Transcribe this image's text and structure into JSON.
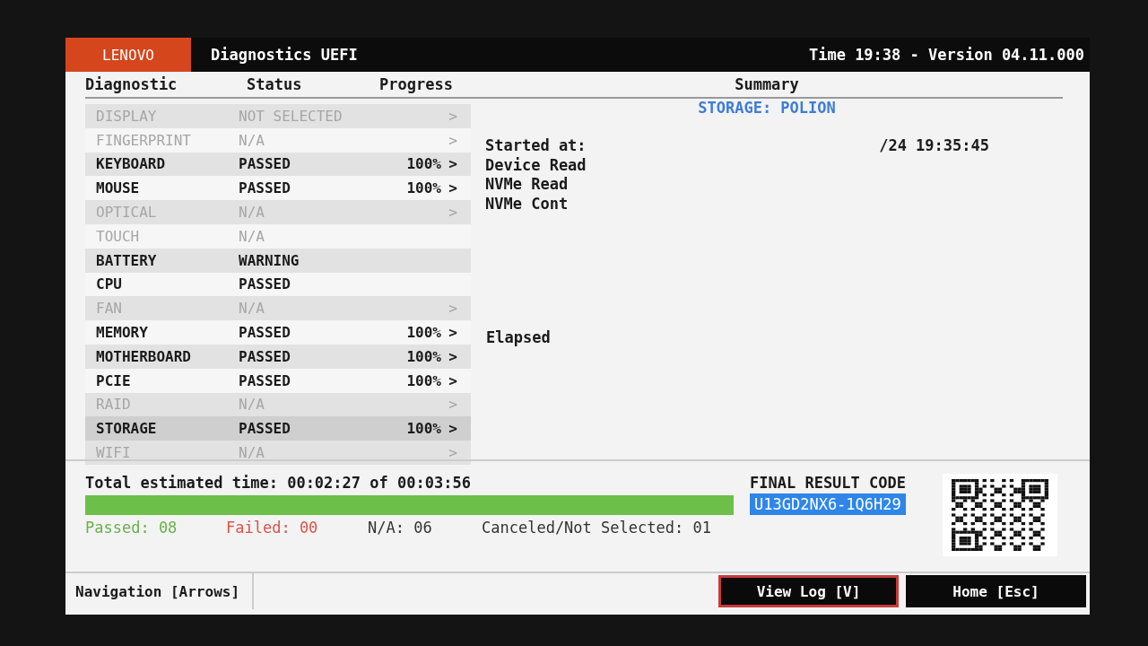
{
  "header": {
    "brand": "LENOVO",
    "title": "Diagnostics UEFI",
    "info": "Time 19:38 - Version 04.11.000"
  },
  "table": {
    "columns": [
      "Diagnostic",
      "Status",
      "Progress"
    ],
    "rows": [
      {
        "name": "DISPLAY",
        "status": "NOT SELECTED",
        "chevron": ">",
        "disabled": true,
        "selected": false
      },
      {
        "name": "FINGERPRINT",
        "status": "N/A",
        "chevron": ">",
        "disabled": true,
        "selected": false
      },
      {
        "name": "KEYBOARD",
        "status": "PASSED",
        "progress": "100%",
        "chevron": ">",
        "disabled": false,
        "selected": false
      },
      {
        "name": "MOUSE",
        "status": "PASSED",
        "progress": "100%",
        "chevron": ">",
        "disabled": false,
        "selected": false
      },
      {
        "name": "OPTICAL",
        "status": "N/A",
        "chevron": ">",
        "disabled": true,
        "selected": false
      },
      {
        "name": "TOUCH",
        "status": "N/A",
        "disabled": true,
        "selected": false
      },
      {
        "name": "BATTERY",
        "status": "WARNING",
        "disabled": false,
        "selected": false
      },
      {
        "name": "CPU",
        "status": "PASSED",
        "disabled": false,
        "selected": false
      },
      {
        "name": "FAN",
        "status": "N/A",
        "chevron": ">",
        "disabled": true,
        "selected": false
      },
      {
        "name": "MEMORY",
        "status": "PASSED",
        "progress": "100%",
        "chevron": ">",
        "disabled": false,
        "selected": false
      },
      {
        "name": "MOTHERBOARD",
        "status": "PASSED",
        "progress": "100%",
        "chevron": ">",
        "disabled": false,
        "selected": false
      },
      {
        "name": "PCIE",
        "status": "PASSED",
        "progress": "100%",
        "chevron": ">",
        "disabled": false,
        "selected": false
      },
      {
        "name": "RAID",
        "status": "N/A",
        "chevron": ">",
        "disabled": true,
        "selected": false
      },
      {
        "name": "STORAGE",
        "status": "PASSED",
        "progress": "100%",
        "chevron": ">",
        "disabled": false,
        "selected": true
      },
      {
        "name": "WIFI",
        "status": "N/A",
        "chevron": ">",
        "disabled": true,
        "selected": false
      }
    ]
  },
  "summary": {
    "title": "Summary",
    "device": "STORAGE: POLION",
    "lines": [
      {
        "label": "Started at:",
        "value": "/24 19:35:45"
      },
      {
        "label": "Device Read"
      },
      {
        "label": "NVMe Read"
      },
      {
        "label": "NVMe Cont"
      }
    ],
    "elapsed": "Elapsed"
  },
  "progress": {
    "total": "Total estimated time: 00:02:27 of 00:03:56",
    "level": 1.0,
    "counts": [
      {
        "label": "Passed: 08",
        "color": "#6ab04c"
      },
      {
        "label": "Failed: 00",
        "color": "#e0524a"
      },
      {
        "label": "N/A: 06",
        "color": "#333333"
      },
      {
        "label": "Canceled/Not Selected: 01",
        "color": "#333333"
      }
    ]
  },
  "final": {
    "label": "FINAL RESULT CODE",
    "code": "U13GD2NX6-1Q6H29"
  },
  "footer": {
    "hint": "Navigation [Arrows]",
    "buttons": [
      {
        "label": "View Log [V]",
        "selected": true
      },
      {
        "label": "Home [Esc]",
        "selected": false
      }
    ]
  }
}
